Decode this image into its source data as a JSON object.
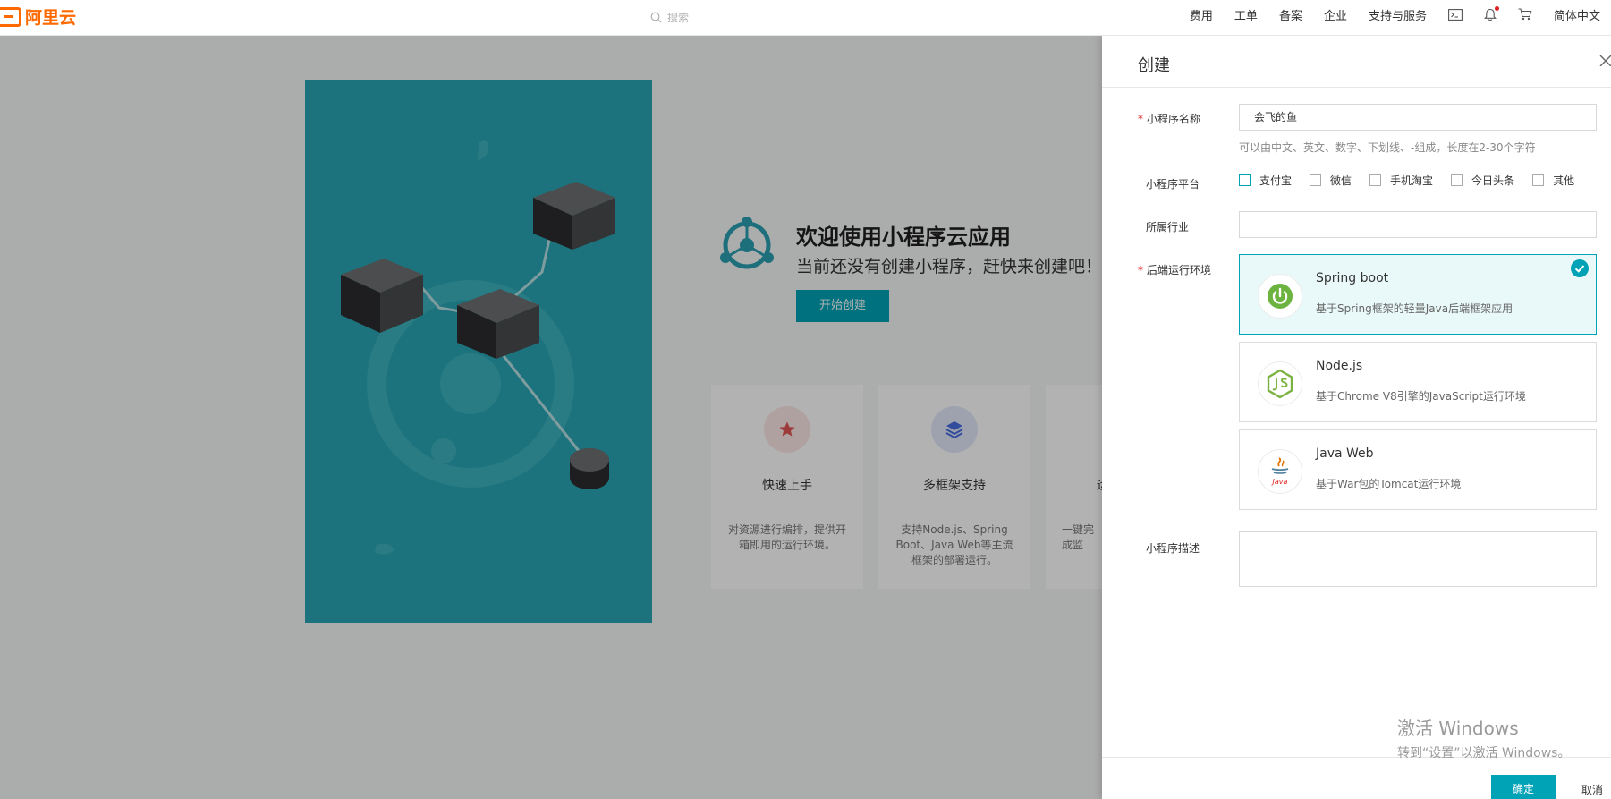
{
  "topbar": {
    "logo": "阿里云",
    "search_placeholder": "搜索",
    "nav": [
      "费用",
      "工单",
      "备案",
      "企业",
      "支持与服务"
    ],
    "language": "简体中文",
    "icons": [
      "terminal-icon",
      "bell-icon",
      "cart-icon"
    ]
  },
  "welcome": {
    "title": "欢迎使用小程序云应用",
    "subtitle": "当前还没有创建小程序，赶快来创建吧！",
    "start_button": "开始创建"
  },
  "features": [
    {
      "title": "快速上手",
      "desc": "对资源进行编排，提供开箱即用的运行环境。",
      "icon": "star-icon"
    },
    {
      "title": "多框架支持",
      "desc": "支持Node.js、Spring Boot、Java Web等主流框架的部署运行。",
      "icon": "layers-icon"
    },
    {
      "title": "运",
      "desc": "一键完成监",
      "icon": "monitor-icon"
    }
  ],
  "drawer": {
    "title": "创建",
    "name_label": "小程序名称",
    "name_value": "会飞的鱼",
    "name_hint": "可以由中文、英文、数字、下划线、-组成，长度在2-30个字符",
    "platform_label": "小程序平台",
    "platforms": [
      "支付宝",
      "微信",
      "手机淘宝",
      "今日头条",
      "其他"
    ],
    "industry_label": "所属行业",
    "industry_value": "",
    "runtime_label": "后端运行环境",
    "runtimes": [
      {
        "name": "Spring boot",
        "desc": "基于Spring框架的轻量Java后端框架应用",
        "selected": true,
        "icon": "spring-power-icon"
      },
      {
        "name": "Node.js",
        "desc": "基于Chrome V8引擎的JavaScript运行环境",
        "selected": false,
        "icon": "nodejs-icon"
      },
      {
        "name": "Java Web",
        "desc": "基于War包的Tomcat运行环境",
        "selected": false,
        "icon": "java-icon"
      }
    ],
    "desc_label": "小程序描述",
    "ok_button": "确定",
    "cancel_button": "取消"
  },
  "watermark": {
    "line1": "激活 Windows",
    "line2": "转到“设置”以激活 Windows。"
  },
  "colors": {
    "accent": "#00a2b5",
    "brand": "#ff6a00",
    "hero": "#2aa5b3"
  }
}
